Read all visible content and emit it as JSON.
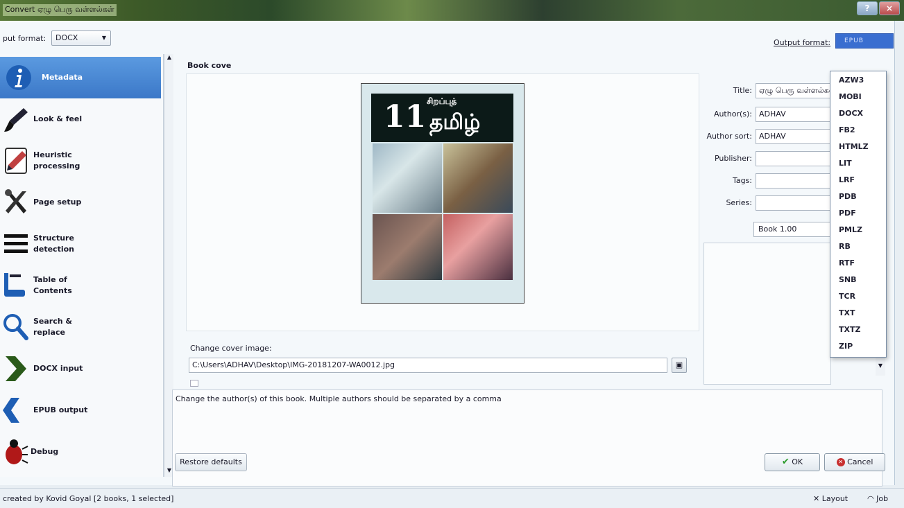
{
  "window": {
    "title": "Convert ஏழு பெரு வள்ளல்கள்"
  },
  "input_format": {
    "label": "put format:",
    "value": "DOCX"
  },
  "output_format": {
    "label": "Output format:",
    "value": "EPUB",
    "options": [
      "AZW3",
      "MOBI",
      "DOCX",
      "FB2",
      "HTMLZ",
      "LIT",
      "LRF",
      "PDB",
      "PDF",
      "PMLZ",
      "RB",
      "RTF",
      "SNB",
      "TCR",
      "TXT",
      "TXTZ",
      "ZIP"
    ]
  },
  "sidebar": {
    "items": [
      {
        "label": "Metadata",
        "icon": "info-icon"
      },
      {
        "label": "Look & feel",
        "icon": "brush-icon"
      },
      {
        "label": "Heuristic processing",
        "icon": "eraser-icon"
      },
      {
        "label": "Page setup",
        "icon": "tools-icon"
      },
      {
        "label": "Structure detection",
        "icon": "list-icon"
      },
      {
        "label": "Table of Contents",
        "icon": "toc-icon"
      },
      {
        "label": "Search & replace",
        "icon": "magnifier-icon"
      },
      {
        "label": "DOCX input",
        "icon": "chevron-right-icon"
      },
      {
        "label": "EPUB output",
        "icon": "chevron-left-icon"
      },
      {
        "label": "Debug",
        "icon": "bug-icon"
      }
    ]
  },
  "cover": {
    "label": "Book cove",
    "title_number": "11",
    "title_top": "சிறப்புத்",
    "title_main": "தமிழ்",
    "change_label": "Change cover image:",
    "path": "C:\\Users\\ADHAV\\Desktop\\IMG-20181207-WA0012.jpg"
  },
  "metadata": {
    "title_label": "Title:",
    "title_value": "ஏழு பெரு வள்ளல்கள்",
    "authors_label": "Author(s):",
    "authors_value": "ADHAV",
    "author_sort_label": "Author sort:",
    "author_sort_value": "ADHAV",
    "publisher_label": "Publisher:",
    "tags_label": "Tags:",
    "series_label": "Series:",
    "series_number": "Book 1.00"
  },
  "help_text": "Change the author(s) of this book. Multiple authors should be separated by a comma",
  "buttons": {
    "restore": "Restore defaults",
    "ok": "OK",
    "cancel": "Cancel"
  },
  "statusbar": {
    "left": "created by Kovid Goyal   [2 books, 1 selected]",
    "layout": "Layout",
    "jobs": "Job"
  },
  "colors": {
    "accent": "#3b78c8",
    "selection": "#3a6ed0"
  }
}
